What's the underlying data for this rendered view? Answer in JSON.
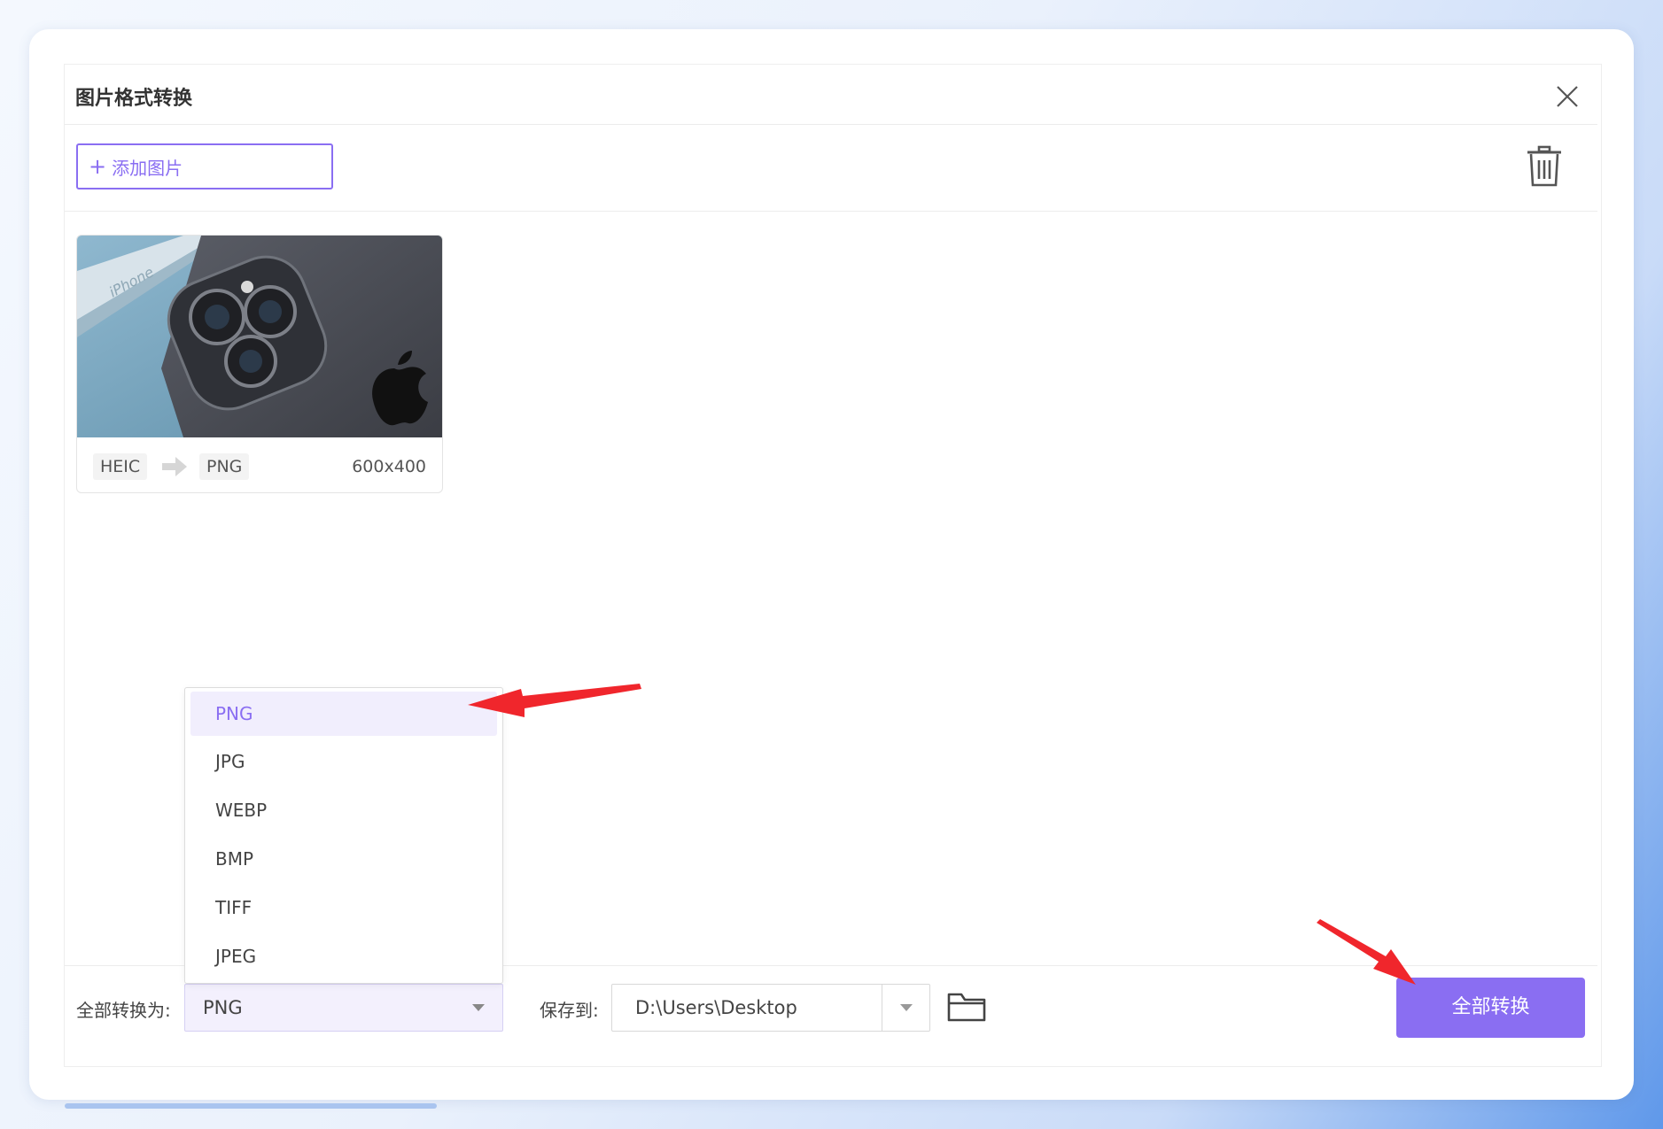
{
  "dialog": {
    "title": "图片格式转换"
  },
  "toolbar": {
    "add_label": "添加图片"
  },
  "files": [
    {
      "from_format": "HEIC",
      "to_format": "PNG",
      "dimensions": "600x400"
    }
  ],
  "footer": {
    "convert_all_label": "全部转换为:",
    "selected_format": "PNG",
    "save_to_label": "保存到:",
    "save_path": "D:\\Users\\Desktop",
    "convert_button": "全部转换"
  },
  "format_options": [
    "PNG",
    "JPG",
    "WEBP",
    "BMP",
    "TIFF",
    "JPEG"
  ],
  "colors": {
    "accent": "#8a6ef2",
    "annotation": "#f0262c"
  },
  "icons": {
    "close": "close-icon",
    "trash": "trash-icon",
    "folder": "folder-icon",
    "arrow": "arrow-right-icon"
  }
}
